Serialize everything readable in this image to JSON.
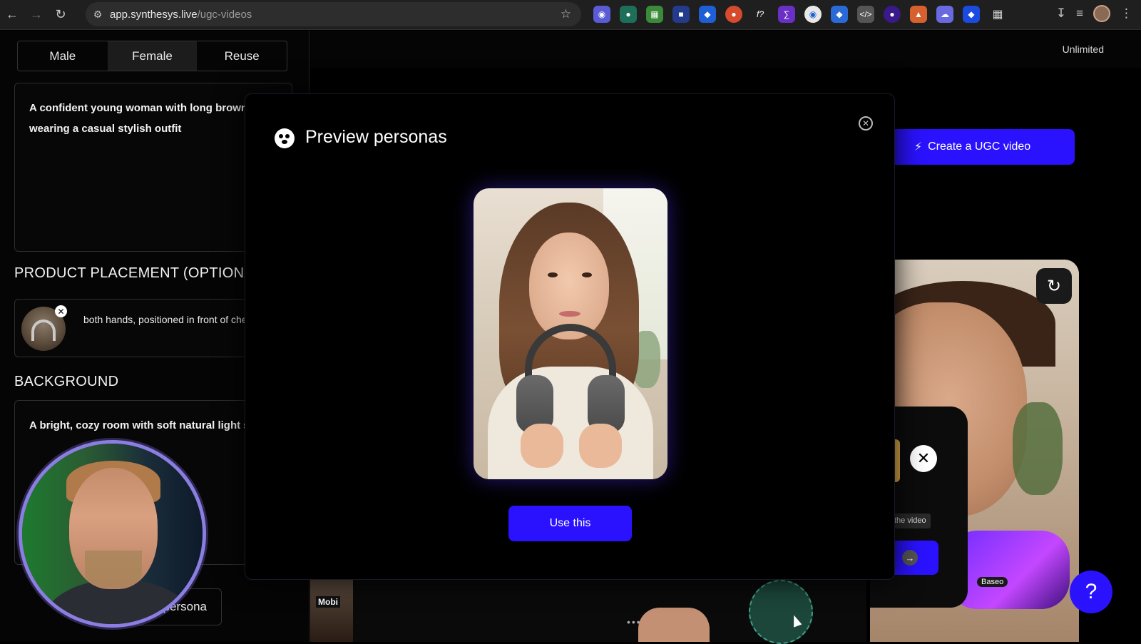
{
  "browser": {
    "url_host": "app.synthesys.live",
    "url_path": "/ugc-videos"
  },
  "left_panel": {
    "tabs": [
      "Male",
      "Female",
      "Reuse"
    ],
    "active_tab": "Female",
    "persona_description": "A confident young woman with long brown wearing a casual stylish outfit",
    "product_placement_title": "PRODUCT PLACEMENT (OPTIONA",
    "product_placement_text": "both hands, positioned in front of chest.",
    "background_title": "BACKGROUND",
    "background_text": "A bright, cozy room with soft natural light simple",
    "persona_button_label": "persona"
  },
  "header": {
    "plan_label": "Unlimited"
  },
  "main": {
    "create_button_label": "Create a UGC video",
    "sub_panel_hint": "the video",
    "sub_panel_paren": ")",
    "thumbnail_brand": "Mobi",
    "speaker_brand": "Baseo"
  },
  "modal": {
    "title": "Preview personas",
    "use_button_label": "Use this"
  },
  "colors": {
    "accent": "#2a12ff",
    "background": "#000000",
    "webcam_border": "#8a7fe0"
  }
}
